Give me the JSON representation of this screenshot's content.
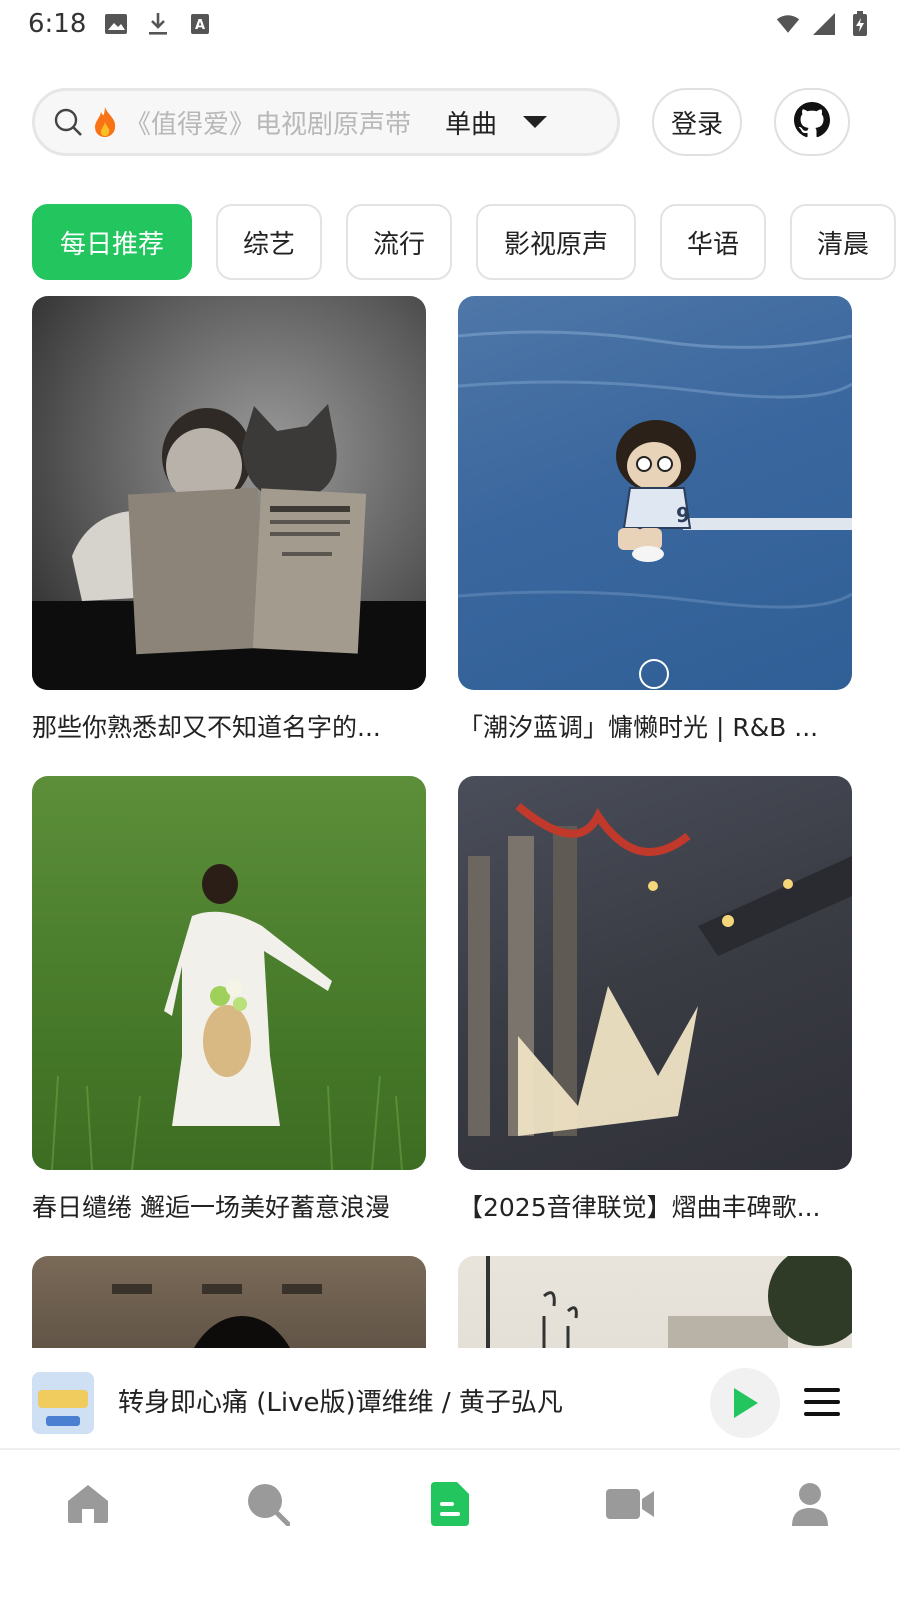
{
  "status_bar": {
    "time": "6:18",
    "left_icons": [
      "image-icon",
      "download-icon",
      "font-icon"
    ],
    "right_icons": [
      "wifi-icon",
      "signal-icon",
      "battery-charging-icon"
    ]
  },
  "search": {
    "placeholder": "《值得爱》电视剧原声带",
    "type": "单曲"
  },
  "header": {
    "login_label": "登录"
  },
  "tabs": [
    {
      "label": "每日推荐",
      "active": true
    },
    {
      "label": "综艺",
      "active": false
    },
    {
      "label": "流行",
      "active": false
    },
    {
      "label": "影视原声",
      "active": false
    },
    {
      "label": "华语",
      "active": false
    },
    {
      "label": "清晨",
      "active": false
    }
  ],
  "playlists": [
    {
      "title": "那些你熟悉却又不知道名字的..."
    },
    {
      "title": "「潮汐蓝调」慵懒时光 | R&B ..."
    },
    {
      "title": "春日缱绻 邂逅一场美好蓄意浪漫"
    },
    {
      "title": "【2025音律联觉】熠曲丰碑歌..."
    },
    {
      "title": ""
    },
    {
      "title": ""
    }
  ],
  "player": {
    "now_playing": "转身即心痛 (Live版)谭维维 / 黄子弘凡"
  },
  "nav": [
    "home-icon",
    "search-icon",
    "document-icon",
    "video-icon",
    "profile-icon"
  ],
  "colors": {
    "accent": "#22c55e",
    "nav_inactive": "#9a9a9a",
    "text": "#222222"
  }
}
